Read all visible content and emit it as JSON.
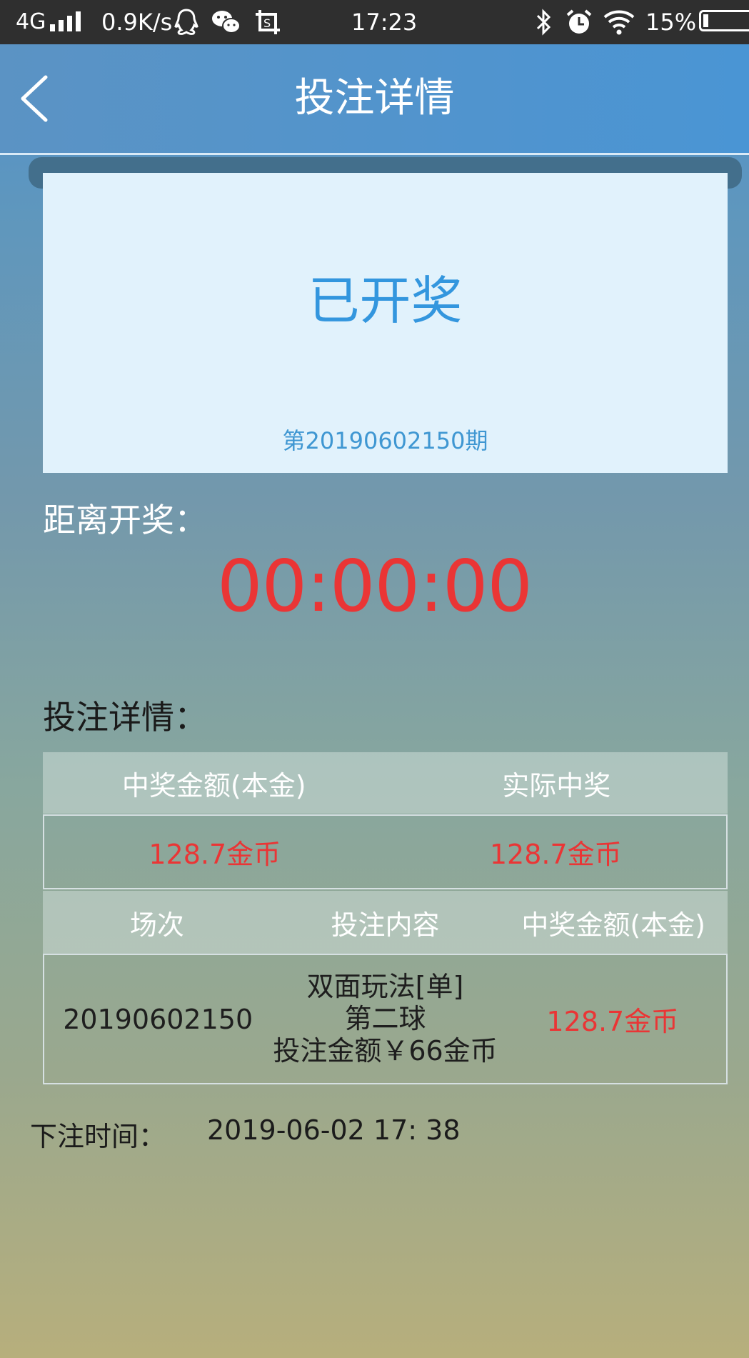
{
  "status_bar": {
    "network": "4G",
    "speed": "0.9K/s",
    "time": "17:23",
    "battery": "15%"
  },
  "header": {
    "title": "投注详情"
  },
  "ticket": {
    "status": "已开奖",
    "period": "第20190602150期"
  },
  "countdown": {
    "label": "距离开奖：",
    "value": "00:00:00"
  },
  "details": {
    "label": "投注详情：",
    "summary": {
      "headers": [
        "中奖金额(本金)",
        "实际中奖"
      ],
      "values": [
        "128.7金币",
        "128.7金币"
      ]
    },
    "bets": {
      "headers": [
        "场次",
        "投注内容",
        "中奖金额(本金)"
      ],
      "rows": [
        {
          "round": "20190602150",
          "content_line1": "双面玩法[单]",
          "content_line2": "第二球",
          "content_line3": "投注金额￥66金币",
          "win": "128.7金币"
        }
      ]
    }
  },
  "bet_time": {
    "label": "下注时间：",
    "value": "2019-06-02 17: 38"
  },
  "colors": {
    "accent_blue": "#3396de",
    "red": "#ea3535"
  }
}
